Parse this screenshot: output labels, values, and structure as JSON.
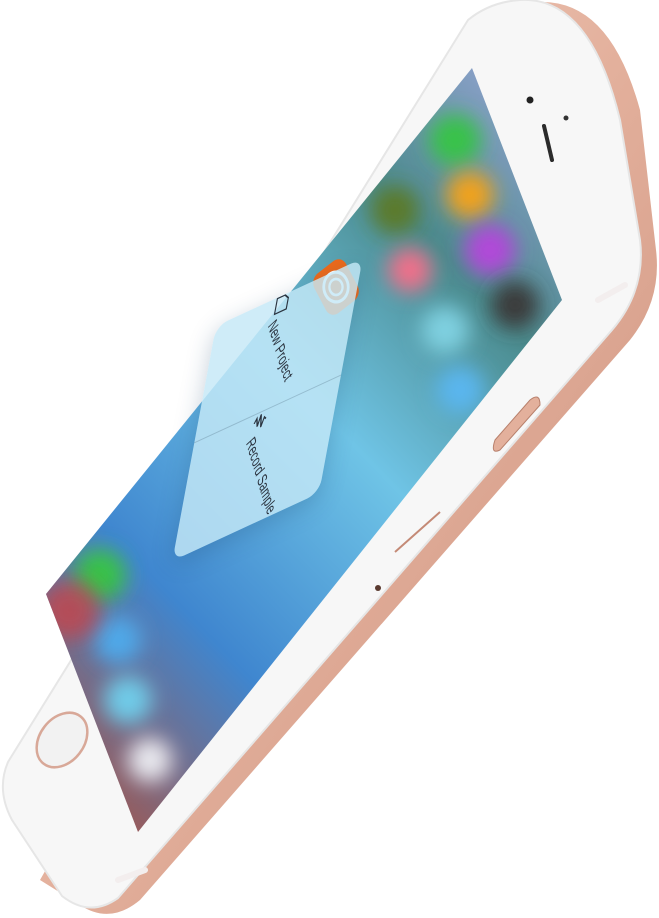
{
  "device": {
    "model": "iPhone",
    "finish_color": "#e8b7a3",
    "bezel_color": "#f5f5f5",
    "screen_accent": "#4b8de0"
  },
  "app_icon": {
    "name": "recording-app-icon",
    "color": "#ee6a1a"
  },
  "quick_actions": [
    {
      "label": "New Project",
      "icon": "document-icon"
    },
    {
      "label": "Record Sample",
      "icon": "waveform-icon"
    }
  ],
  "blurred_home_icons": [
    {
      "color": "#37c24a"
    },
    {
      "color": "#f0a21c"
    },
    {
      "color": "#b048d8"
    },
    {
      "color": "#3a3a3a"
    },
    {
      "color": "#5ab6ee"
    },
    {
      "color": "#d43d3d"
    }
  ]
}
